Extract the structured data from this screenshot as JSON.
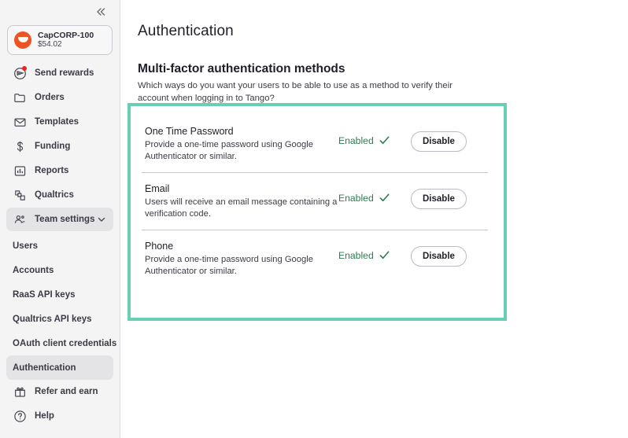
{
  "sidebar": {
    "collapse_icon": "chevrons-left-icon",
    "account": {
      "name": "CapCORP-100",
      "balance": "$54.02",
      "logo_color": "#f05323"
    },
    "nav": [
      {
        "label": "Send rewards",
        "icon": "send-icon",
        "badge": true
      },
      {
        "label": "Orders",
        "icon": "folder-icon",
        "badge": false
      },
      {
        "label": "Templates",
        "icon": "envelope-icon",
        "badge": false
      },
      {
        "label": "Funding",
        "icon": "dollar-icon",
        "badge": false
      },
      {
        "label": "Reports",
        "icon": "bar-chart-icon",
        "badge": false
      },
      {
        "label": "Qualtrics",
        "icon": "qualtrics-icon",
        "badge": false
      },
      {
        "label": "Team settings",
        "icon": "people-icon",
        "badge": false,
        "expanded": true,
        "chevron": "chevron-down-icon"
      }
    ],
    "subnav": [
      {
        "label": "Users",
        "active": false
      },
      {
        "label": "Accounts",
        "active": false
      },
      {
        "label": "RaaS API keys",
        "active": false
      },
      {
        "label": "Qualtrics API keys",
        "active": false
      },
      {
        "label": "OAuth client credentials",
        "active": false
      },
      {
        "label": "Authentication",
        "active": true
      }
    ],
    "bottom_nav": [
      {
        "label": "Refer and earn",
        "icon": "gift-icon"
      },
      {
        "label": "Help",
        "icon": "help-circle-icon"
      }
    ]
  },
  "main": {
    "page_title": "Authentication",
    "section_title": "Multi-factor authentication methods",
    "section_description": "Which ways do you want your users to be able to use as a method to verify their account when logging in to Tango?",
    "highlight_color": "#66cfb4",
    "methods": [
      {
        "name": "One Time Password",
        "description": "Provide a one-time password using Google Authenticator or similar.",
        "status": "Enabled",
        "status_icon": "check-icon",
        "action_label": "Disable"
      },
      {
        "name": "Email",
        "description": "Users will receive an email message containing a verification code.",
        "status": "Enabled",
        "status_icon": "check-icon",
        "action_label": "Disable"
      },
      {
        "name": "Phone",
        "description": "Provide a one-time password using Google Authenticator or similar.",
        "status": "Enabled",
        "status_icon": "check-icon",
        "action_label": "Disable"
      }
    ]
  }
}
